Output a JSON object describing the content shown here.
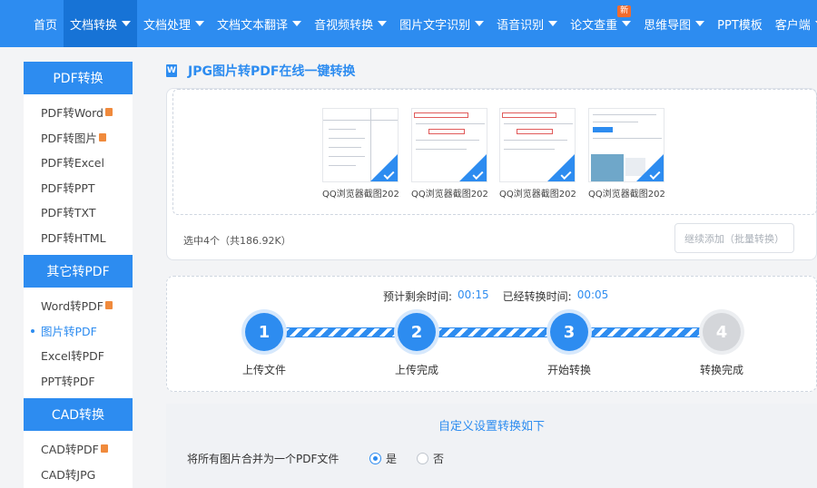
{
  "nav": {
    "items": [
      {
        "label": "首页",
        "caret": false,
        "active": false
      },
      {
        "label": "文档转换",
        "caret": true,
        "active": true
      },
      {
        "label": "文档处理",
        "caret": true,
        "active": false
      },
      {
        "label": "文档文本翻译",
        "caret": true,
        "active": false
      },
      {
        "label": "音视频转换",
        "caret": true,
        "active": false
      },
      {
        "label": "图片文字识别",
        "caret": true,
        "active": false
      },
      {
        "label": "语音识别",
        "caret": true,
        "active": false
      },
      {
        "label": "论文查重",
        "caret": true,
        "active": false,
        "badge": "新"
      },
      {
        "label": "思维导图",
        "caret": true,
        "active": false
      },
      {
        "label": "PPT模板",
        "caret": false,
        "active": false
      },
      {
        "label": "客户端",
        "caret": true,
        "active": false
      }
    ]
  },
  "sidebar": {
    "groups": [
      {
        "title": "PDF转换",
        "items": [
          {
            "label": "PDF转Word",
            "hot": true
          },
          {
            "label": "PDF转图片",
            "hot": true
          },
          {
            "label": "PDF转Excel",
            "hot": false
          },
          {
            "label": "PDF转PPT",
            "hot": false
          },
          {
            "label": "PDF转TXT",
            "hot": false
          },
          {
            "label": "PDF转HTML",
            "hot": false
          }
        ]
      },
      {
        "title": "其它转PDF",
        "items": [
          {
            "label": "Word转PDF",
            "hot": true
          },
          {
            "label": "图片转PDF",
            "hot": false,
            "active": true
          },
          {
            "label": "Excel转PDF",
            "hot": false
          },
          {
            "label": "PPT转PDF",
            "hot": false
          }
        ]
      },
      {
        "title": "CAD转换",
        "items": [
          {
            "label": "CAD转PDF",
            "hot": true
          },
          {
            "label": "CAD转JPG",
            "hot": false
          }
        ]
      }
    ]
  },
  "page": {
    "icon_letter": "W",
    "title": "JPG图片转PDF在线一键转换"
  },
  "upload": {
    "files": [
      {
        "name": "QQ浏览器截图202..."
      },
      {
        "name": "QQ浏览器截图202..."
      },
      {
        "name": "QQ浏览器截图202..."
      },
      {
        "name": "QQ浏览器截图202..."
      }
    ],
    "selected_info": "选中4个（共186.92K）",
    "add_more_label": "继续添加（批量转换）"
  },
  "progress": {
    "remaining_label": "预计剩余时间:",
    "remaining_value": "00:15",
    "elapsed_label": "已经转换时间:",
    "elapsed_value": "00:05",
    "steps": [
      {
        "num": "1",
        "label": "上传文件",
        "done": true
      },
      {
        "num": "2",
        "label": "上传完成",
        "done": true
      },
      {
        "num": "3",
        "label": "开始转换",
        "done": true
      },
      {
        "num": "4",
        "label": "转换完成",
        "done": false
      }
    ]
  },
  "settings": {
    "title": "自定义设置转换如下",
    "merge_label": "将所有图片合并为一个PDF文件",
    "options": [
      {
        "label": "是",
        "checked": true
      },
      {
        "label": "否",
        "checked": false
      }
    ]
  },
  "colors": {
    "accent": "#2d8cf0",
    "hot": "#f08a3c",
    "badge": "#f26b2e"
  }
}
